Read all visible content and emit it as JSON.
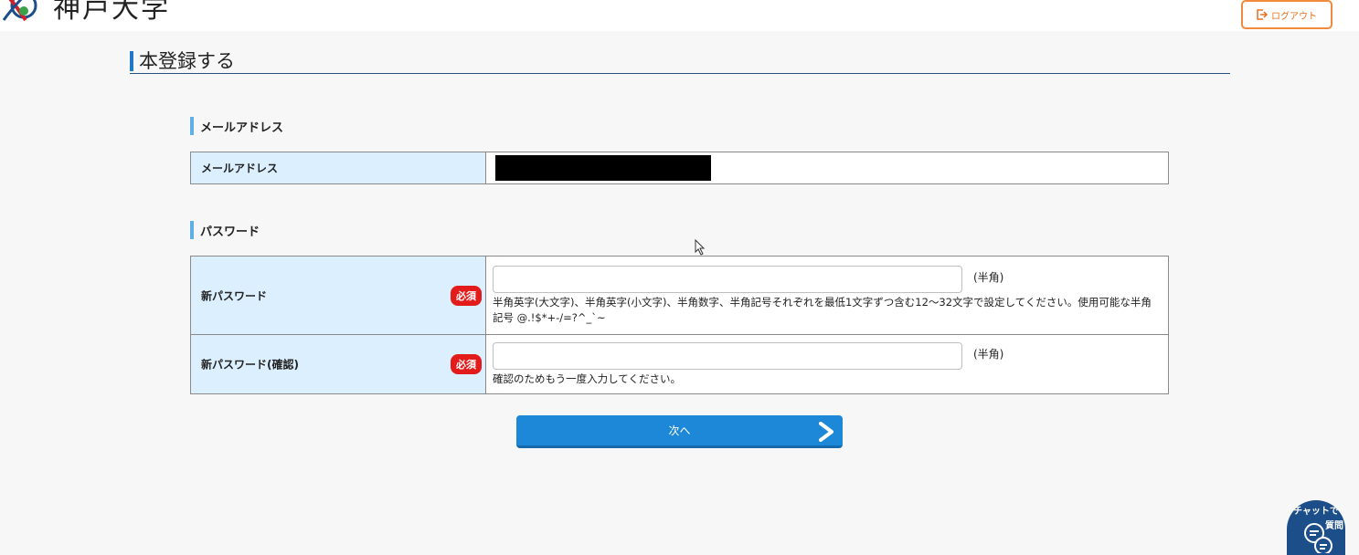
{
  "header": {
    "logo_text": "神戸大学",
    "logout_label": "ログアウト"
  },
  "page": {
    "title": "本登録する"
  },
  "email_section": {
    "heading": "メールアドレス",
    "field_label": "メールアドレス"
  },
  "password_section": {
    "heading": "パスワード",
    "rows": [
      {
        "label": "新パスワード",
        "required_badge": "必須",
        "input_value": "",
        "suffix": "(半角)",
        "help": "半角英字(大文字)、半角英字(小文字)、半角数字、半角記号それぞれを最低1文字ずつ含む12〜32文字で設定してください。使用可能な半角記号 @.!$*+-/=?^_`~"
      },
      {
        "label": "新パスワード(確認)",
        "required_badge": "必須",
        "input_value": "",
        "suffix": "(半角)",
        "help": "確認のためもう一度入力してください。"
      }
    ]
  },
  "actions": {
    "next_label": "次へ"
  },
  "chat": {
    "line1": "チャットで",
    "line2": "質問"
  },
  "colors": {
    "accent_blue": "#1e88d8",
    "logout_orange": "#f08a3c",
    "required_red": "#e21b1b",
    "label_bg": "#dcefff"
  }
}
